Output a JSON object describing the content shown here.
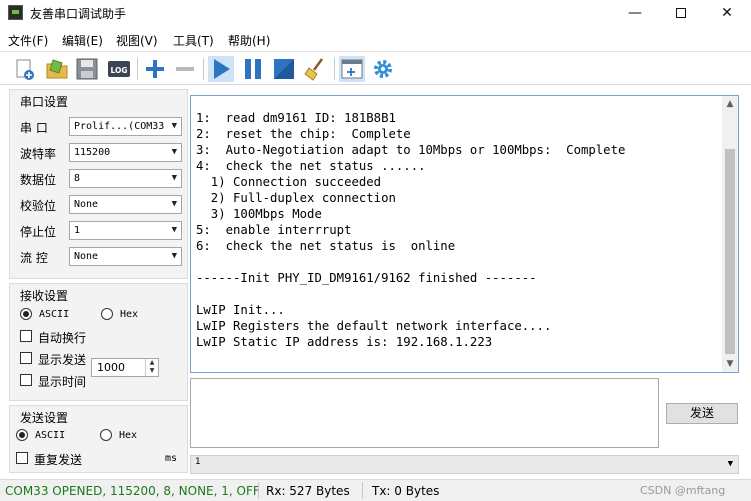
{
  "window": {
    "title": "友善串口调试助手",
    "minimize": "—",
    "close": "✕"
  },
  "menu": [
    {
      "label": "文件(F)"
    },
    {
      "label": "编辑(E)"
    },
    {
      "label": "视图(V)"
    },
    {
      "label": "工具(T)"
    },
    {
      "label": "帮助(H)"
    }
  ],
  "toolbar": {
    "log_label": "LOG",
    "accent": "#2f74c0"
  },
  "serial_settings": {
    "title": "串口设置",
    "port": {
      "label": "串  口",
      "value": "Prolif...(COM33"
    },
    "baud": {
      "label": "波特率",
      "value": "115200"
    },
    "databits": {
      "label": "数据位",
      "value": "8"
    },
    "parity": {
      "label": "校验位",
      "value": "None"
    },
    "stopbits": {
      "label": "停止位",
      "value": "1"
    },
    "flow": {
      "label": "流  控",
      "value": "None"
    }
  },
  "receive_settings": {
    "title": "接收设置",
    "ascii": "ASCII",
    "hex": "Hex",
    "auto_wrap": "自动换行",
    "show_send": "显示发送",
    "show_time": "显示时间"
  },
  "send_settings": {
    "title": "发送设置",
    "ascii": "ASCII",
    "hex": "Hex",
    "repeat": "重复发送",
    "interval": "1000",
    "unit": "ms"
  },
  "receive_text": [
    "1:  read dm9161 ID: 181B8B1",
    "2:  reset the chip:  Complete",
    "3:  Auto-Negotiation adapt to 10Mbps or 100Mbps:  Complete",
    "4:  check the net status ......",
    "  1) Connection succeeded",
    "  2) Full-duplex connection",
    "  3) 100Mbps Mode",
    "5:  enable interrrupt",
    "6:  check the net status is  online",
    "",
    "------Init PHY_ID_DM9161/9162 finished -------",
    "",
    "LwIP Init...",
    "LwIP Registers the default network interface....",
    "LwIP Static IP address is: 192.168.1.223"
  ],
  "send_button": "发送",
  "send_history_value": "1",
  "status": {
    "port_state": "COM33 OPENED, 115200, 8, NONE, 1, OFF",
    "port_state_color": "#1a7a1a",
    "rx": "Rx: 527 Bytes",
    "tx": "Tx: 0 Bytes"
  },
  "watermark": "CSDN @mftang"
}
